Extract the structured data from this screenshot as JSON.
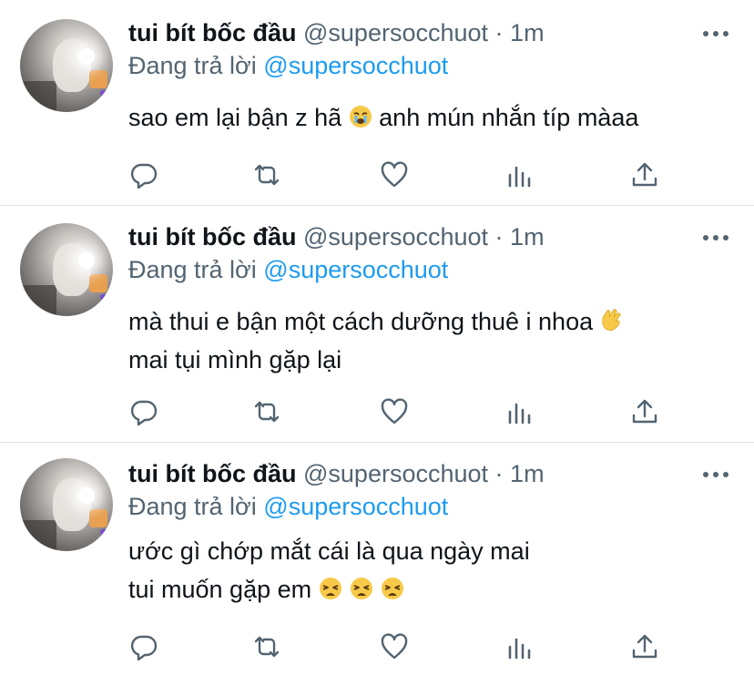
{
  "tweets": [
    {
      "name": "tui bít bốc đầu",
      "handle": "@supersocchuot",
      "dot": "·",
      "time": "1m",
      "reply_prefix": "Đang trả lời",
      "reply_to": "@supersocchuot",
      "lines": [
        {
          "text": "sao em lại bận z hã ",
          "emoji": "crying-face",
          "suffix": "  anh mún nhắn típ màaa"
        }
      ]
    },
    {
      "name": "tui bít bốc đầu",
      "handle": "@supersocchuot",
      "dot": "·",
      "time": "1m",
      "reply_prefix": "Đang trả lời",
      "reply_to": "@supersocchuot",
      "lines": [
        {
          "text": "mà thui e bận một cách dưỡng thuê i nhoa ",
          "emoji": "waving-hand"
        },
        {
          "text": "mai tụi mình gặp lại"
        }
      ]
    },
    {
      "name": "tui bít bốc đầu",
      "handle": "@supersocchuot",
      "dot": "·",
      "time": "1m",
      "reply_prefix": "Đang trả lời",
      "reply_to": "@supersocchuot",
      "lines": [
        {
          "text": "ước gì chớp mắt cái là qua ngày mai"
        },
        {
          "text": "tui muốn gặp em ",
          "emoji": "weary-face-x3"
        }
      ]
    }
  ],
  "icons": {
    "reply": "reply-icon",
    "retweet": "retweet-icon",
    "like": "heart-icon",
    "analytics": "analytics-icon",
    "share": "share-icon",
    "more": "more-icon"
  },
  "colors": {
    "text": "#0f1419",
    "secondary": "#536471",
    "accent": "#1d9bf0",
    "divider": "#dfe3e7"
  }
}
